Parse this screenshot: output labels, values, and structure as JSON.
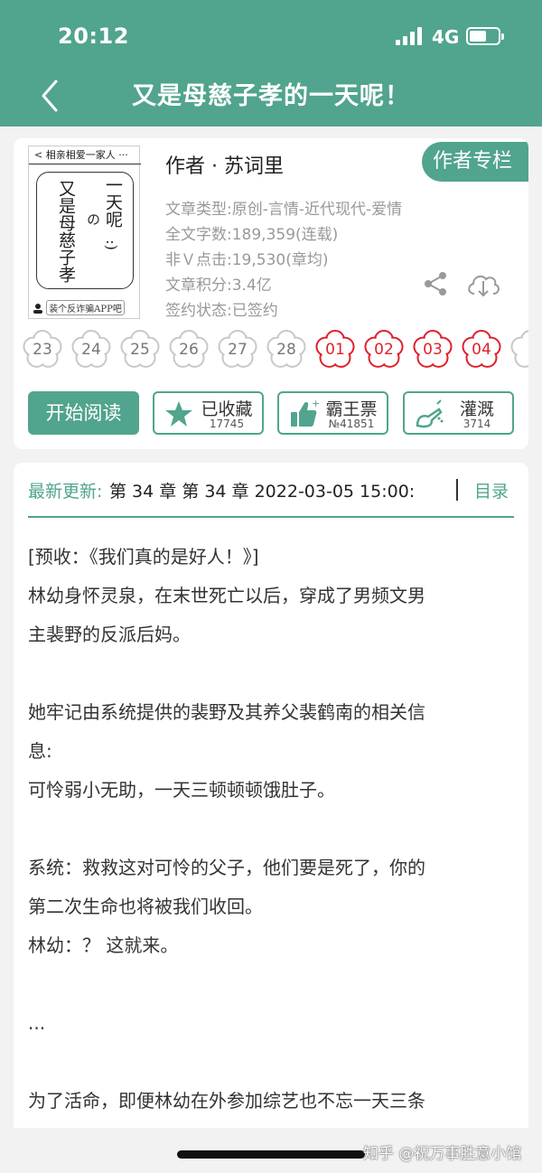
{
  "status_bar": {
    "time": "20:12",
    "network": "4G",
    "battery_percent": 60
  },
  "nav": {
    "title": "又是母慈子孝的一天呢！",
    "back_icon": "chevron-left-icon"
  },
  "colors": {
    "brand": "#51a48d",
    "flower_active": "#e0202a",
    "flower_inactive": "#c8c8c8"
  },
  "book": {
    "cover": {
      "top_text": "相亲相爱一家人",
      "title_col1": "又是母慈子孝",
      "title_col2": "の",
      "title_col3": "一天呢",
      "emoticon": ":)",
      "bottom_text": "装个反诈骗APP吧"
    },
    "author_line": "作者 · 苏词里",
    "author_column_button": "作者专栏",
    "info": [
      "文章类型:原创-言情-近代现代-爱情",
      "全文字数:189,359(连载)",
      "非Ｖ点击:19,530(章均)",
      "文章积分:3.4亿",
      "签约状态:已签约"
    ],
    "share_icon": "share-icon",
    "download_icon": "cloud-download-icon"
  },
  "calendar_flowers": [
    {
      "label": "23",
      "active": false
    },
    {
      "label": "24",
      "active": false
    },
    {
      "label": "25",
      "active": false
    },
    {
      "label": "26",
      "active": false
    },
    {
      "label": "27",
      "active": false
    },
    {
      "label": "28",
      "active": false
    },
    {
      "label": "01",
      "active": true
    },
    {
      "label": "02",
      "active": true
    },
    {
      "label": "03",
      "active": true
    },
    {
      "label": "04",
      "active": true
    }
  ],
  "actions": {
    "start_reading": "开始阅读",
    "collect": {
      "label": "已收藏",
      "count": "17745",
      "icon": "star-icon"
    },
    "vote": {
      "label": "霸王票",
      "count": "№41851",
      "icon": "thumbs-up-icon"
    },
    "water": {
      "label": "灌溉",
      "count": "3714",
      "icon": "watering-can-icon"
    }
  },
  "latest": {
    "label": "最新更新:",
    "text": "第 34 章 第 34 章 2022-03-05 15:00:",
    "toc": "目录"
  },
  "intro": [
    "[预收：《我们真的是好人！》]",
    "林幼身怀灵泉，在末世死亡以后，穿成了男频文男",
    "主裴野的反派后妈。",
    "",
    "她牢记由系统提供的裴野及其养父裴鹤南的相关信",
    "息:",
    "可怜弱小无助，一天三顿顿顿饿肚子。",
    "",
    "系统：救救这对可怜的父子，他们要是死了，你的",
    "第二次生命也将被我们收回。",
    "林幼：？ 这就来。",
    "",
    "...",
    "",
    "为了活命，即便林幼在外参加综艺也不忘一天三条"
  ],
  "watermark": "知乎 @祝万事胜意小馆"
}
